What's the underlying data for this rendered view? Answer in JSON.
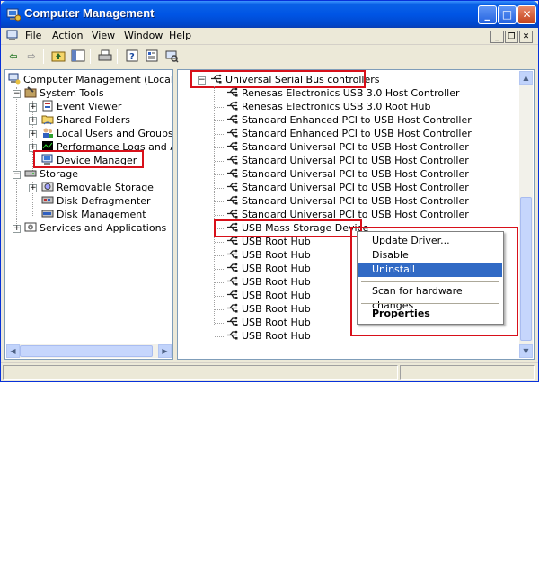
{
  "window": {
    "title": "Computer Management"
  },
  "menu": {
    "file": "File",
    "action": "Action",
    "view": "View",
    "window": "Window",
    "help": "Help"
  },
  "left_tree": {
    "root": "Computer Management (Local)",
    "system_tools": "System Tools",
    "event_viewer": "Event Viewer",
    "shared_folders": "Shared Folders",
    "local_users": "Local Users and Groups",
    "perf_logs": "Performance Logs and Alerts",
    "device_manager": "Device Manager",
    "storage": "Storage",
    "removable_storage": "Removable Storage",
    "disk_defrag": "Disk Defragmenter",
    "disk_mgmt": "Disk Management",
    "services": "Services and Applications"
  },
  "right_tree": {
    "category": "Universal Serial Bus controllers",
    "devices": [
      "Renesas Electronics USB 3.0 Host Controller",
      "Renesas Electronics USB 3.0 Root Hub",
      "Standard Enhanced PCI to USB Host Controller",
      "Standard Enhanced PCI to USB Host Controller",
      "Standard Universal PCI to USB Host Controller",
      "Standard Universal PCI to USB Host Controller",
      "Standard Universal PCI to USB Host Controller",
      "Standard Universal PCI to USB Host Controller",
      "Standard Universal PCI to USB Host Controller",
      "Standard Universal PCI to USB Host Controller",
      "USB Mass Storage Device",
      "USB Root Hub",
      "USB Root Hub",
      "USB Root Hub",
      "USB Root Hub",
      "USB Root Hub",
      "USB Root Hub",
      "USB Root Hub",
      "USB Root Hub"
    ]
  },
  "context_menu": {
    "update_driver": "Update Driver...",
    "disable": "Disable",
    "uninstall": "Uninstall",
    "scan": "Scan for hardware changes",
    "properties": "Properties"
  },
  "colors": {
    "highlight_box": "#d8101a",
    "selection": "#316ac5",
    "titlebar": "#0055e5"
  }
}
